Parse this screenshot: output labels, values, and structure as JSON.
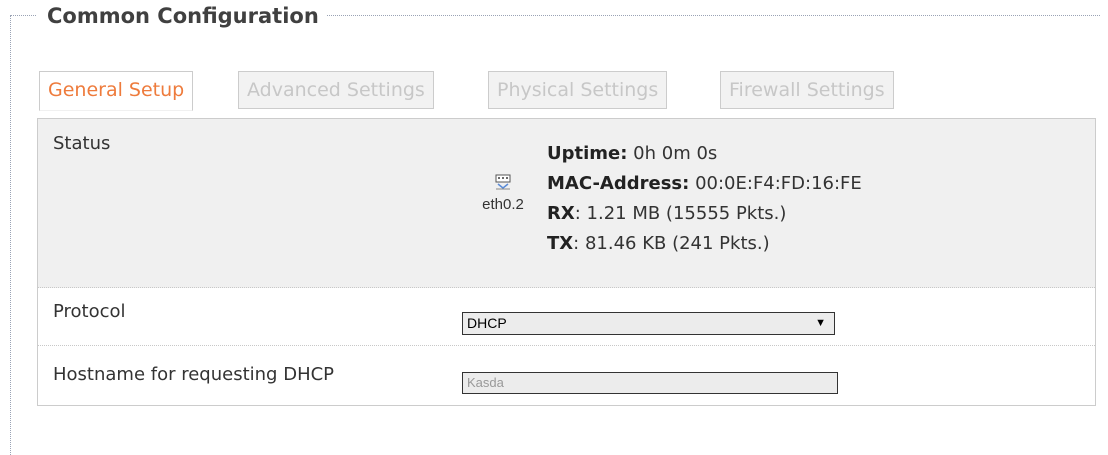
{
  "section": {
    "title": "Common Configuration"
  },
  "tabs": [
    {
      "label": "General Setup",
      "active": true
    },
    {
      "label": "Advanced Settings",
      "active": false
    },
    {
      "label": "Physical Settings",
      "active": false
    },
    {
      "label": "Firewall Settings",
      "active": false
    }
  ],
  "status": {
    "label": "Status",
    "device_name": "eth0.2",
    "device_icon": "ethernet-port-icon",
    "uptime_label": "Uptime:",
    "uptime_value": " 0h 0m 0s",
    "mac_label": "MAC-Address:",
    "mac_value": " 00:0E:F4:FD:16:FE",
    "rx_label": "RX",
    "rx_value": ": 1.21 MB (15555 Pkts.)",
    "tx_label": "TX",
    "tx_value": ": 81.46 KB (241 Pkts.)"
  },
  "protocol": {
    "label": "Protocol",
    "selected": "DHCP"
  },
  "hostname": {
    "label": "Hostname for requesting DHCP",
    "placeholder": "Kasda"
  },
  "colors": {
    "active_tab": "#ee7b3c",
    "inactive_tab": "#c7c7c7",
    "panel_bg": "#f0f0f0"
  }
}
